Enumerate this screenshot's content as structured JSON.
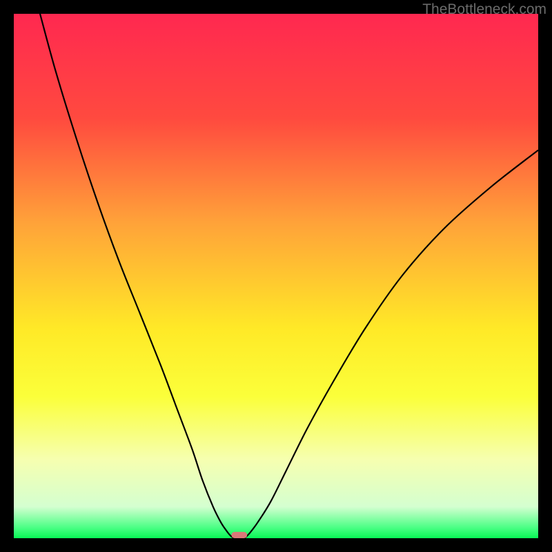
{
  "watermark": "TheBottleneck.com",
  "chart_data": {
    "type": "line",
    "title": "",
    "xlabel": "",
    "ylabel": "",
    "xlim": [
      0,
      100
    ],
    "ylim": [
      0,
      100
    ],
    "background_gradient": {
      "stops": [
        {
          "offset": 0,
          "color": "#ff2850"
        },
        {
          "offset": 20,
          "color": "#ff4a3f"
        },
        {
          "offset": 40,
          "color": "#ffa339"
        },
        {
          "offset": 60,
          "color": "#ffe927"
        },
        {
          "offset": 73,
          "color": "#fbff3a"
        },
        {
          "offset": 85,
          "color": "#f6ffb0"
        },
        {
          "offset": 94,
          "color": "#d4ffd0"
        },
        {
          "offset": 98,
          "color": "#4aff84"
        },
        {
          "offset": 100,
          "color": "#08f755"
        }
      ]
    },
    "series": [
      {
        "name": "left-branch",
        "color": "#000000",
        "x": [
          5,
          8,
          12,
          16,
          20,
          24,
          28,
          31,
          34,
          36,
          38,
          39.5,
          40.5,
          41.3,
          42
        ],
        "y": [
          100,
          89,
          76,
          64,
          53,
          43,
          33,
          25,
          17,
          11,
          6,
          3,
          1.5,
          0.5,
          0
        ]
      },
      {
        "name": "right-branch",
        "color": "#000000",
        "x": [
          44,
          45,
          46.5,
          49,
          52,
          56,
          61,
          67,
          74,
          82,
          91,
          100
        ],
        "y": [
          0,
          1,
          3,
          7,
          13,
          21,
          30,
          40,
          50,
          59,
          67,
          74
        ]
      }
    ],
    "marker": {
      "name": "bottom-marker",
      "x": 43,
      "y": 0,
      "width": 3,
      "height": 1.2,
      "color": "#d97878"
    }
  }
}
